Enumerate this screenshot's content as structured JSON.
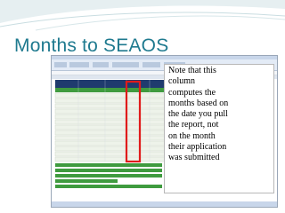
{
  "slide": {
    "title": "Months to SEAOS",
    "callout": "Note that this\ncolumn\ncomputes the\nmonths based on\nthe date you pull\nthe report, not\non the month\ntheir application\nwas submitted"
  },
  "colors": {
    "title": "#1f7a8f",
    "highlight_box": "#e01b1b",
    "excel_header": "#1f3b6e",
    "excel_row_band": "#3f9b3f",
    "swoosh": "#cfe0e3"
  }
}
